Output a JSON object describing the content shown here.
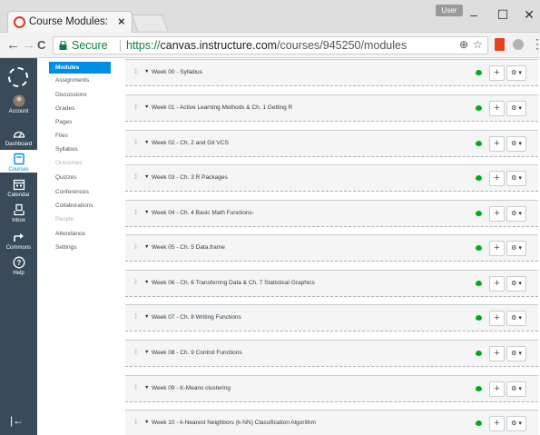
{
  "browser": {
    "tab_title": "Course Modules: SSCRL",
    "tab_close": "×",
    "user_chip": "User",
    "win_min": "–",
    "win_max": "☐",
    "win_close": "✕",
    "back": "←",
    "forward": "→",
    "reload": "C",
    "secure_label": "Secure",
    "url_scheme": "https://",
    "url_host": "canvas.instructure.com",
    "url_path": "/courses/945250/modules",
    "zoom_icon": "⊕",
    "star_icon": "☆",
    "menu": "⋮"
  },
  "global_nav": {
    "items": [
      {
        "label": "Account",
        "icon": "avatar-icon"
      },
      {
        "label": "Dashboard",
        "icon": "dashboard-icon"
      },
      {
        "label": "Courses",
        "icon": "courses-icon"
      },
      {
        "label": "Calendar",
        "icon": "calendar-icon"
      },
      {
        "label": "Inbox",
        "icon": "inbox-icon"
      },
      {
        "label": "Commons",
        "icon": "commons-icon"
      },
      {
        "label": "Help",
        "icon": "help-icon"
      }
    ],
    "collapse": "|←"
  },
  "course_nav": {
    "items": [
      {
        "label": "Modules",
        "state": "active"
      },
      {
        "label": "Assignments",
        "state": "normal"
      },
      {
        "label": "Discussions",
        "state": "normal"
      },
      {
        "label": "Grades",
        "state": "normal"
      },
      {
        "label": "Pages",
        "state": "normal"
      },
      {
        "label": "Files",
        "state": "normal"
      },
      {
        "label": "Syllabus",
        "state": "normal"
      },
      {
        "label": "Outcomes",
        "state": "disabled"
      },
      {
        "label": "Quizzes",
        "state": "normal"
      },
      {
        "label": "Conferences",
        "state": "normal"
      },
      {
        "label": "Collaborations",
        "state": "normal"
      },
      {
        "label": "People",
        "state": "disabled"
      },
      {
        "label": "Attendance",
        "state": "normal"
      },
      {
        "label": "Settings",
        "state": "normal"
      }
    ]
  },
  "modules": [
    {
      "title": "Week 00 - Syllabus"
    },
    {
      "title": "Week 01 - Active Learning Methods & Ch. 1 Getting R"
    },
    {
      "title": "Week 02 - Ch. 2 and Git VCS"
    },
    {
      "title": "Week 03 - Ch. 3 R Packages"
    },
    {
      "title": "Week 04 - Ch. 4 Basic Math Functions-"
    },
    {
      "title": "Week 05 - Ch. 5 Data.frame"
    },
    {
      "title": "Week 06 - Ch. 6 Transferring Data & Ch. 7 Statistical Graphics"
    },
    {
      "title": "Week 07 - Ch. 8 Writing Functions"
    },
    {
      "title": "Week 08 - Ch. 9 Control Functions"
    },
    {
      "title": "Week 09 - K-Means clustering"
    },
    {
      "title": "Week 10 - k-Nearest Neighbors (k-NN) Classification Algorithm"
    }
  ],
  "module_controls": {
    "add": "+",
    "settings": "⚙ ▾",
    "drag": "⁞⁞",
    "caret": "▼"
  },
  "colors": {
    "global_nav_bg": "#394b58",
    "active_blue": "#008ee2",
    "published_green": "#00ac18",
    "secure_green": "#0b8043"
  }
}
